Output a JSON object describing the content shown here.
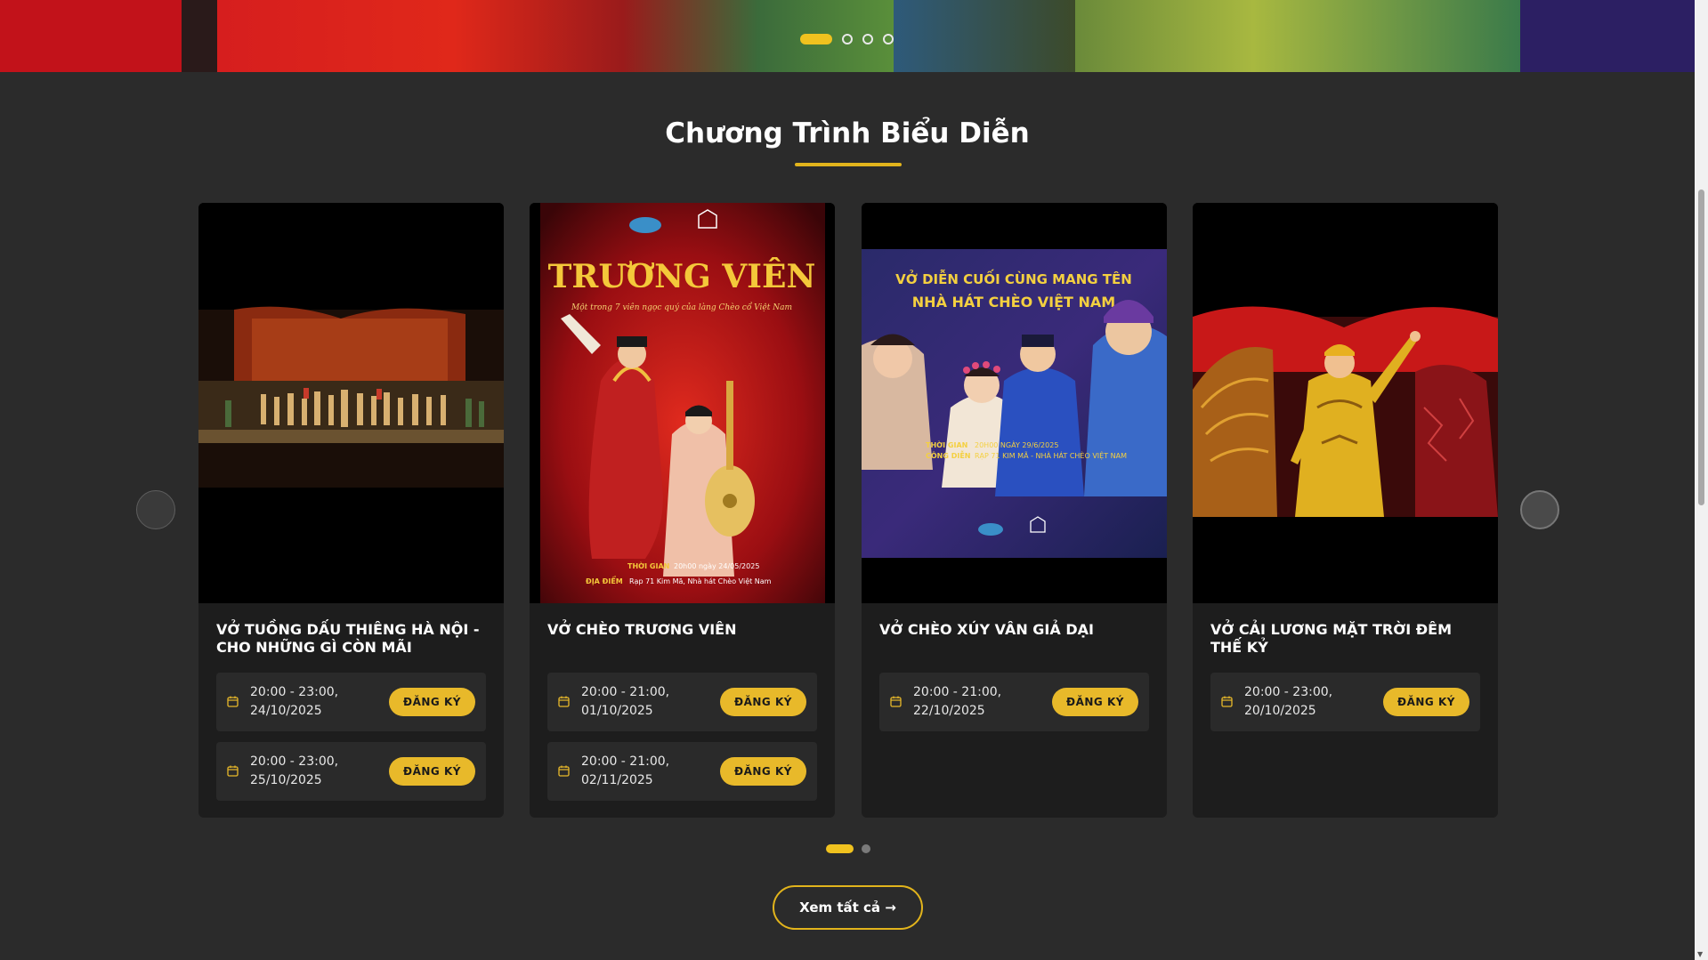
{
  "hero": {
    "dots": [
      true,
      false,
      false,
      false
    ]
  },
  "section": {
    "title": "Chương Trình Biểu Diễn"
  },
  "carousel": {
    "prev_icon": "chevron-left-icon",
    "next_icon": "chevron-right-icon",
    "cards": [
      {
        "title": "VỞ TUỒNG DẤU THIÊNG HÀ NỘI - CHO NHỮNG GÌ CÒN MÃI",
        "shows": [
          {
            "time_line1": "20:00 - 23:00,",
            "time_line2": "24/10/2025",
            "button": "ĐĂNG KÝ"
          },
          {
            "time_line1": "20:00 - 23:00,",
            "time_line2": "25/10/2025",
            "button": "ĐĂNG KÝ"
          }
        ]
      },
      {
        "title": "VỞ CHÈO TRƯƠNG VIÊN",
        "poster": {
          "headline": "TRƯƠNG VIÊN",
          "tagline": "Một trong 7 viên ngọc quý của làng Chèo cổ Việt Nam",
          "time_label": "THỜI GIAN",
          "time_value": "20h00 ngày 24/05/2025",
          "place_label": "ĐỊA ĐIỂM",
          "place_value": "Rạp 71 Kim Mã, Nhà hát Chèo Việt Nam"
        },
        "shows": [
          {
            "time_line1": "20:00 - 21:00,",
            "time_line2": "01/10/2025",
            "button": "ĐĂNG KÝ"
          },
          {
            "time_line1": "20:00 - 21:00,",
            "time_line2": "02/11/2025",
            "button": "ĐĂNG KÝ"
          }
        ]
      },
      {
        "title": "VỞ CHÈO XÚY VÂN GIẢ DẠI",
        "poster": {
          "headline_line1": "VỞ DIỄN CUỐI CÙNG MANG TÊN",
          "headline_line2": "NHÀ HÁT CHÈO VIỆT NAM",
          "time_label_1": "THỜI GIAN",
          "time_label_2": "CÔNG DIỄN",
          "time_value": "20H00 NGÀY 29/6/2025",
          "place_value": "RẠP 71 KIM MÃ - NHÀ HÁT CHÈO VIỆT NAM"
        },
        "shows": [
          {
            "time_line1": "20:00 - 21:00,",
            "time_line2": "22/10/2025",
            "button": "ĐĂNG KÝ"
          }
        ]
      },
      {
        "title": "VỞ CẢI LƯƠNG MẶT TRỜI ĐÊM THẾ KỶ",
        "shows": [
          {
            "time_line1": "20:00 - 23:00,",
            "time_line2": "20/10/2025",
            "button": "ĐĂNG KÝ"
          }
        ]
      }
    ]
  },
  "pager": {
    "dots": [
      true,
      false
    ]
  },
  "view_all": {
    "label": "Xem tất cả →"
  },
  "colors": {
    "accent": "#e8b92a",
    "background": "#2b2b2b",
    "card": "#1d1d1d"
  }
}
